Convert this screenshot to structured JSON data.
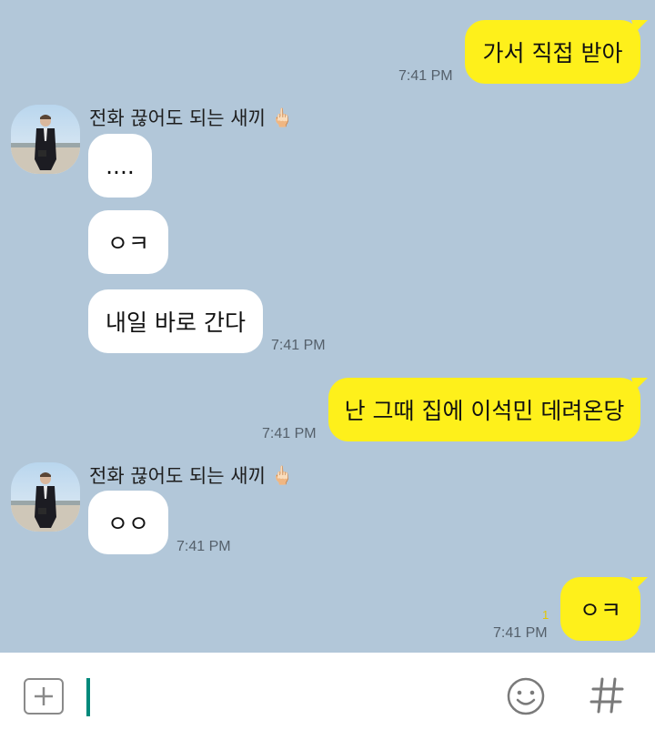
{
  "messages": [
    {
      "text": "가서 직접 받아",
      "time": "7:41 PM"
    },
    {
      "sender": "전화 끊어도 되는 새끼",
      "sender_emoji": "🖕🏻",
      "text": "...."
    },
    {
      "text": "ㅇㅋ"
    },
    {
      "text": "내일 바로 간다",
      "time": "7:41 PM"
    },
    {
      "text": "난 그때 집에 이석민 데려온당",
      "time": "7:41 PM"
    },
    {
      "sender": "전화 끊어도 되는 새끼",
      "sender_emoji": "🖕🏻",
      "text": "ㅇㅇ",
      "time": "7:41 PM"
    },
    {
      "text": "ㅇㅋ",
      "time": "7:41 PM",
      "unread": "1"
    }
  ],
  "composer": {
    "input_value": ""
  },
  "colors": {
    "background": "#b2c7d9",
    "my_bubble": "#fef01b",
    "other_bubble": "#ffffff",
    "cursor": "#00897b"
  },
  "icons": {
    "attach": "plus-square-icon",
    "emoji": "smiley-icon",
    "hashtag": "hashtag-icon"
  }
}
